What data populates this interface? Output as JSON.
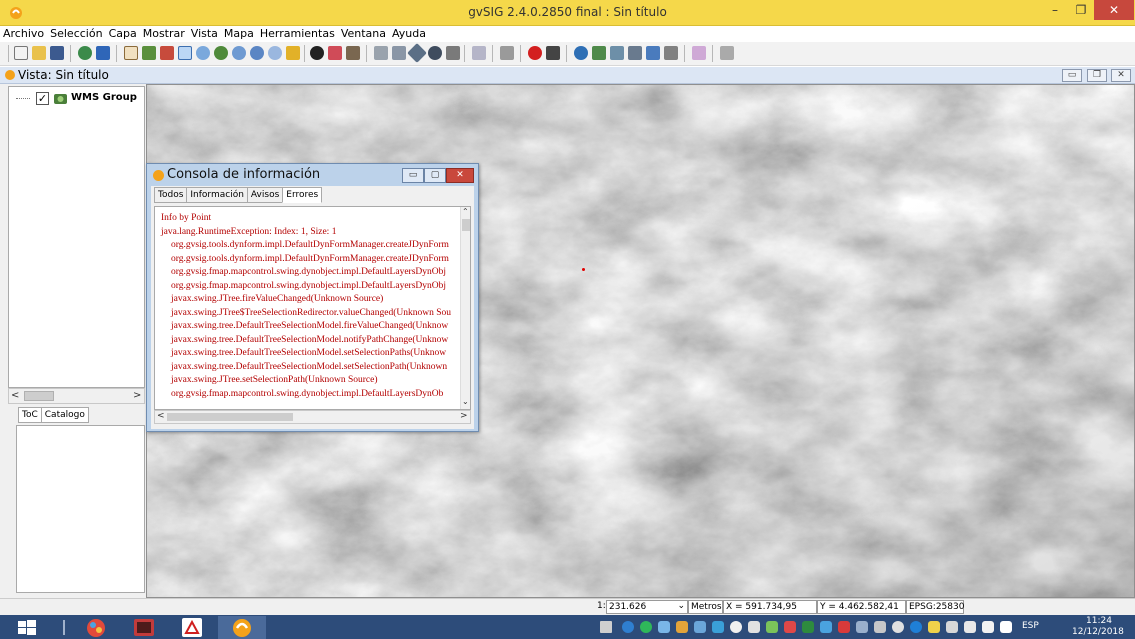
{
  "window": {
    "title": "gvSIG 2.4.0.2850 final : Sin título",
    "minimize": "–",
    "maximize": "❐",
    "close": "✕"
  },
  "menu": [
    "Archivo",
    "Selección",
    "Capa",
    "Mostrar",
    "Vista",
    "Mapa",
    "Herramientas",
    "Ventana",
    "Ayuda"
  ],
  "view": {
    "title": "Vista: Sin título"
  },
  "toc": {
    "layer_label": "WMS Group",
    "layer_checked": "✓",
    "tabs": [
      "ToC",
      "Catalogo"
    ]
  },
  "statusbar": {
    "scale_prefix": "1:",
    "scale_value": "231.626",
    "units": "Metros",
    "x_coord": "X = 591.734,95",
    "y_coord": "Y = 4.462.582,41",
    "epsg": "EPSG:25830"
  },
  "console": {
    "title": "Consola de información",
    "tabs": [
      "Todos",
      "Información",
      "Avisos",
      "Errores"
    ],
    "active_tab": "Errores",
    "lines": [
      "Info by Point",
      "java.lang.RuntimeException: Index: 1, Size: 1",
      "org.gvsig.tools.dynform.impl.DefaultDynFormManager.createJDynForm",
      "org.gvsig.tools.dynform.impl.DefaultDynFormManager.createJDynForm",
      "org.gvsig.fmap.mapcontrol.swing.dynobject.impl.DefaultLayersDynObj",
      "org.gvsig.fmap.mapcontrol.swing.dynobject.impl.DefaultLayersDynObj",
      "javax.swing.JTree.fireValueChanged(Unknown Source)",
      "javax.swing.JTree$TreeSelectionRedirector.valueChanged(Unknown Sou",
      "javax.swing.tree.DefaultTreeSelectionModel.fireValueChanged(Unknow",
      "javax.swing.tree.DefaultTreeSelectionModel.notifyPathChange(Unknow",
      "javax.swing.tree.DefaultTreeSelectionModel.setSelectionPaths(Unknow",
      "javax.swing.tree.DefaultTreeSelectionModel.setSelectionPath(Unknown",
      "javax.swing.JTree.setSelectionPath(Unknown Source)",
      "org.gvsig.fmap.mapcontrol.swing.dynobject.impl.DefaultLayersDynOb"
    ]
  },
  "taskbar": {
    "language": "ESP",
    "time": "11:24",
    "date": "12/12/2018"
  },
  "colors": {
    "titlebar": "#f5d84a",
    "taskbar": "#2d4c7a",
    "console_text": "#b30000"
  }
}
